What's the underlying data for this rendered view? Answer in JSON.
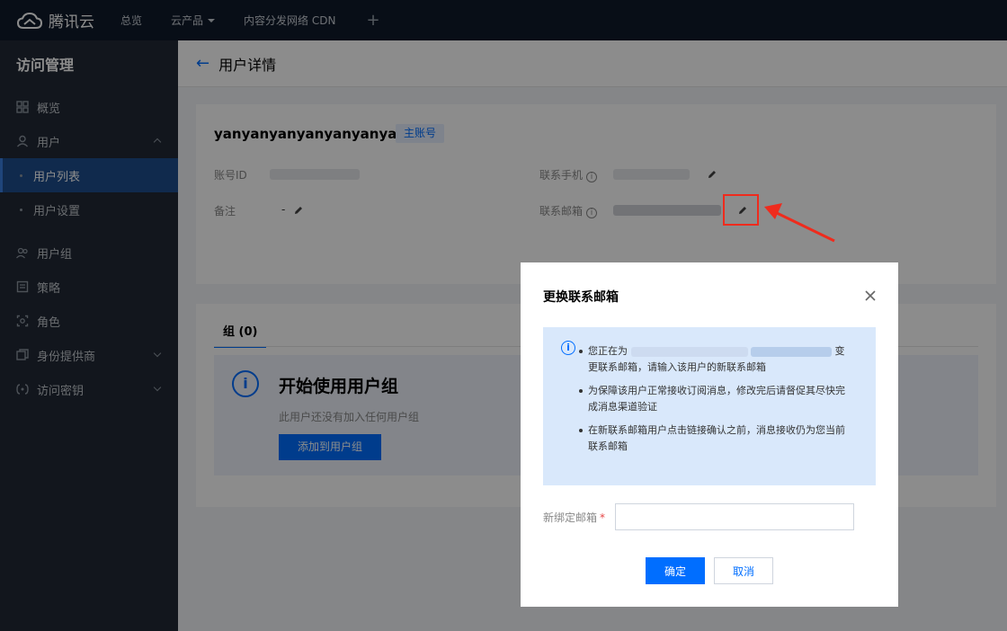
{
  "topbar": {
    "brand": "腾讯云",
    "nav": [
      "总览",
      "云产品",
      "内容分发网络 CDN"
    ],
    "add_symbol": "+"
  },
  "sidebar": {
    "title": "访问管理",
    "items": [
      {
        "label": "概览",
        "icon": "grid-icon"
      },
      {
        "label": "用户",
        "icon": "user-icon",
        "expanded": true
      },
      {
        "label": "用户列表",
        "active": true
      },
      {
        "label": "用户设置"
      },
      {
        "label": "用户组",
        "icon": "users-icon"
      },
      {
        "label": "策略",
        "icon": "policy-icon"
      },
      {
        "label": "角色",
        "icon": "role-icon"
      },
      {
        "label": "身份提供商",
        "icon": "idp-icon"
      },
      {
        "label": "访问密钥",
        "icon": "key-icon"
      }
    ]
  },
  "page": {
    "title": "用户详情",
    "username": "yanyanyanyanyanyanyan",
    "badge": "主账号",
    "fields": {
      "account_id_label": "账号ID",
      "remark_label": "备注",
      "remark_value": "-",
      "phone_label": "联系手机",
      "email_label": "联系邮箱"
    },
    "tab": "组 (0)",
    "empty": {
      "title": "开始使用用户组",
      "desc": "此用户还没有加入任何用户组",
      "button": "添加到用户组"
    }
  },
  "modal": {
    "title": "更换联系邮箱",
    "notice": {
      "line1_prefix": "您正在为",
      "line1_suffix": "变更联系邮箱，请输入该用户的新联系邮箱",
      "line2": "为保障该用户正常接收订阅消息，修改完后请督促其尽快完成消息渠道验证",
      "line3": "在新联系邮箱用户点击链接确认之前，消息接收仍为您当前联系邮箱"
    },
    "field_label": "新绑定邮箱",
    "required_mark": "*",
    "input_value": "",
    "input_placeholder": "",
    "confirm": "确定",
    "cancel": "取消"
  },
  "colors": {
    "accent": "#006eff",
    "annotation_red": "#ef2b1d",
    "topbar": "#0f1b2b",
    "sidebar": "#212835"
  }
}
